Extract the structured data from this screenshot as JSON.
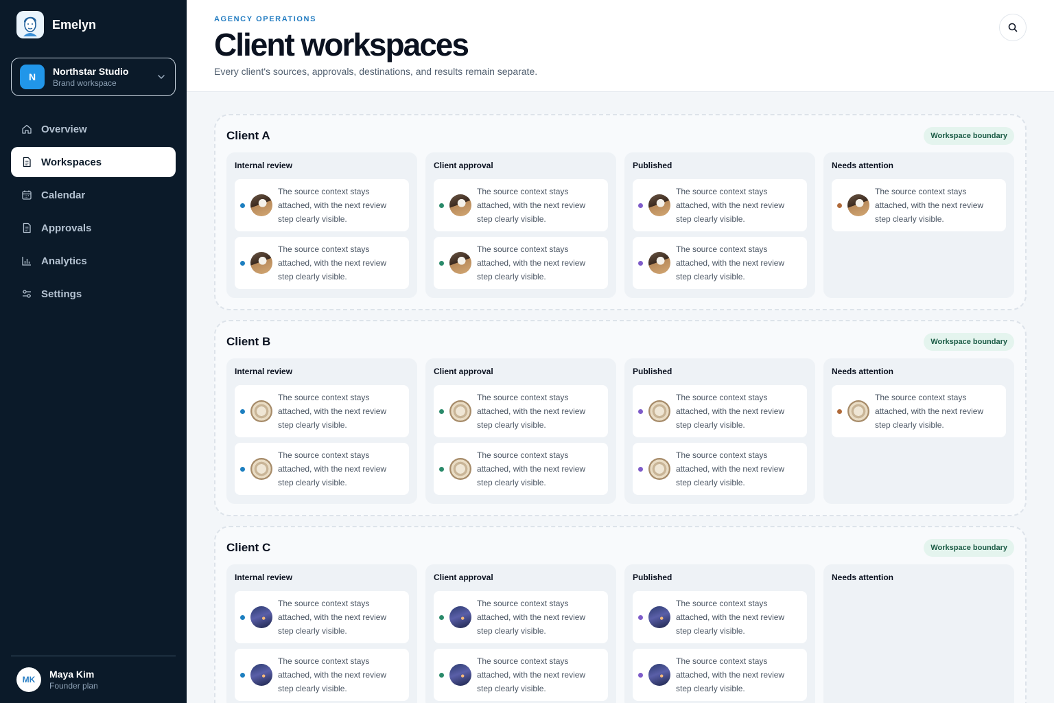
{
  "app": {
    "name": "Emelyn"
  },
  "workspace_switcher": {
    "initial": "N",
    "name": "Northstar Studio",
    "subtitle": "Brand workspace"
  },
  "nav": {
    "items": [
      {
        "label": "Overview",
        "icon": "home-icon",
        "active": false
      },
      {
        "label": "Workspaces",
        "icon": "document-icon",
        "active": true
      },
      {
        "label": "Calendar",
        "icon": "calendar-icon",
        "active": false
      },
      {
        "label": "Approvals",
        "icon": "document-icon",
        "active": false
      },
      {
        "label": "Analytics",
        "icon": "bar-chart-icon",
        "active": false
      },
      {
        "label": "Settings",
        "icon": "sliders-icon",
        "active": false
      }
    ]
  },
  "user": {
    "initials": "MK",
    "name": "Maya Kim",
    "plan": "Founder plan"
  },
  "header": {
    "eyebrow": "AGENCY OPERATIONS",
    "title": "Client workspaces",
    "subtitle": "Every client's sources, approvals, destinations, and results remain separate.",
    "search_icon": "search-icon"
  },
  "colors": {
    "sidebar": "#0b1a29",
    "accent": "#1f7ac0",
    "internal_review": "#1d7fc0",
    "client_approval": "#2a8a6a",
    "published": "#7e5cc9",
    "needs_attention": "#b06a3a"
  },
  "clients": [
    {
      "name": "Client A",
      "badge": "Workspace boundary",
      "thumbnail": "desk-photo",
      "columns": [
        {
          "title": "Internal review",
          "cards": [
            "The source context stays attached, with the next review step clearly visible.",
            "The source context stays attached, with the next review step clearly visible."
          ]
        },
        {
          "title": "Client approval",
          "cards": [
            "The source context stays attached, with the next review step clearly visible.",
            "The source context stays attached, with the next review step clearly visible."
          ]
        },
        {
          "title": "Published",
          "cards": [
            "The source context stays attached, with the next review step clearly visible.",
            "The source context stays attached, with the next review step clearly visible."
          ]
        },
        {
          "title": "Needs attention",
          "cards": [
            "The source context stays attached, with the next review step clearly visible."
          ]
        }
      ]
    },
    {
      "name": "Client B",
      "badge": "Workspace boundary",
      "thumbnail": "paper-photo",
      "columns": [
        {
          "title": "Internal review",
          "cards": [
            "The source context stays attached, with the next review step clearly visible.",
            "The source context stays attached, with the next review step clearly visible."
          ]
        },
        {
          "title": "Client approval",
          "cards": [
            "The source context stays attached, with the next review step clearly visible.",
            "The source context stays attached, with the next review step clearly visible."
          ]
        },
        {
          "title": "Published",
          "cards": [
            "The source context stays attached, with the next review step clearly visible.",
            "The source context stays attached, with the next review step clearly visible."
          ]
        },
        {
          "title": "Needs attention",
          "cards": [
            "The source context stays attached, with the next review step clearly visible."
          ]
        }
      ]
    },
    {
      "name": "Client C",
      "badge": "Workspace boundary",
      "thumbnail": "night-photo",
      "columns": [
        {
          "title": "Internal review",
          "cards": [
            "The source context stays attached, with the next review step clearly visible.",
            "The source context stays attached, with the next review step clearly visible."
          ]
        },
        {
          "title": "Client approval",
          "cards": [
            "The source context stays attached, with the next review step clearly visible.",
            "The source context stays attached, with the next review step clearly visible."
          ]
        },
        {
          "title": "Published",
          "cards": [
            "The source context stays attached, with the next review step clearly visible.",
            "The source context stays attached, with the next review step clearly visible."
          ]
        },
        {
          "title": "Needs attention",
          "cards": []
        }
      ]
    }
  ]
}
